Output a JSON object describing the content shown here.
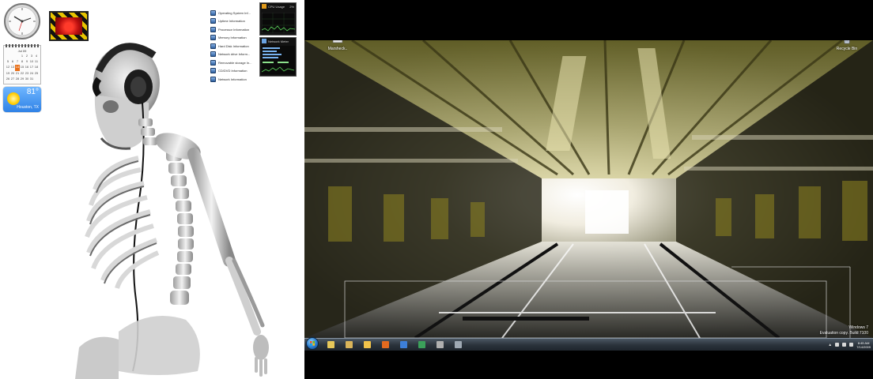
{
  "left_monitor": {
    "calendar": {
      "month": "Jul 09",
      "days": [
        "1",
        "2",
        "3",
        "4",
        "5",
        "6",
        "7",
        "8",
        "9",
        "10",
        "11",
        "12",
        "13",
        "14",
        "15",
        "16",
        "17",
        "18",
        "19",
        "20",
        "21",
        "22",
        "23",
        "24",
        "25",
        "26",
        "27",
        "28",
        "29",
        "30",
        "31"
      ],
      "today": "14"
    },
    "weather": {
      "temperature": "81°",
      "location": "Houston, TX"
    },
    "system_info": {
      "items": [
        "Operating System Inf...",
        "Uptime Information",
        "Processor Information",
        "Memory Information",
        "Hard Disk Information",
        "Network drive Inform...",
        "Removable storage In...",
        "CD/DVD Information",
        "Network Information"
      ]
    },
    "cpu_meter": {
      "title": "CPU Usage",
      "value": "2%"
    },
    "network_meter": {
      "title": "Network Meter"
    }
  },
  "right_monitor": {
    "desktop_icons": [
      {
        "label": "Marsheck..",
        "icon": "computer-icon"
      },
      {
        "label": "Recycle Bin",
        "icon": "recycle-bin-icon"
      }
    ],
    "watermark": {
      "line1": "Windows 7",
      "line2": "Evaluation copy. Build 7100"
    },
    "taskbar": {
      "pinned": [
        {
          "name": "windows-explorer",
          "color": "#e6c75a"
        },
        {
          "name": "paint",
          "color": "#d9b45a"
        },
        {
          "name": "mail",
          "color": "#f0c24a"
        },
        {
          "name": "firefox",
          "color": "#e36a1f"
        },
        {
          "name": "word",
          "color": "#3d7fd8"
        },
        {
          "name": "excel",
          "color": "#3ba05a"
        },
        {
          "name": "media",
          "color": "#b0b0b0"
        },
        {
          "name": "app",
          "color": "#9fa9b3"
        }
      ],
      "clock": {
        "time": "8:45 AM",
        "date": "7/14/2009"
      }
    }
  },
  "colors": {
    "taskbar": "#2a323a",
    "accent_yellow": "#b8a020"
  }
}
